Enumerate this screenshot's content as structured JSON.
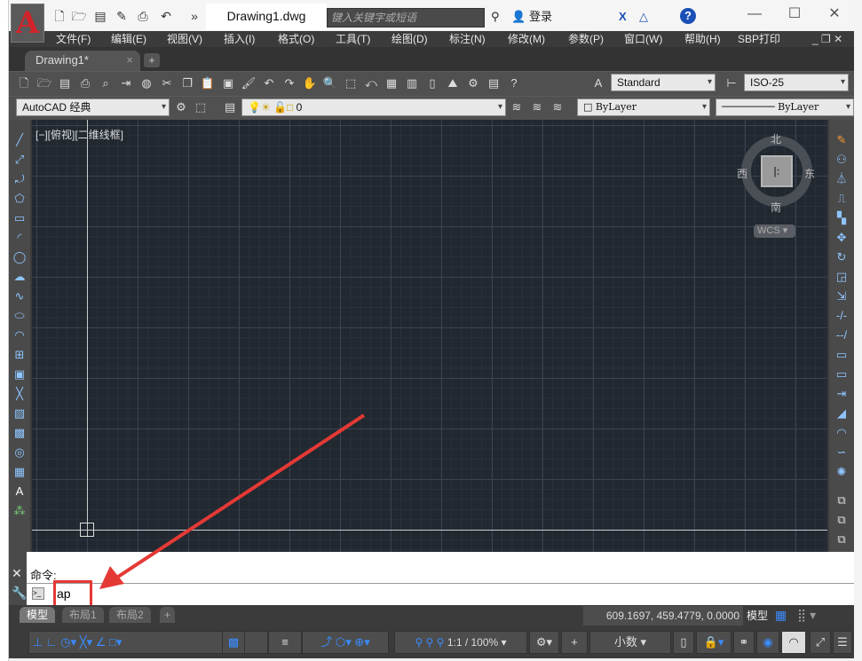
{
  "title": {
    "app_logo": "A",
    "document": "Drawing1.dwg",
    "search_placeholder": "键入关键字或短语",
    "signin": "登录",
    "window_controls": [
      "—",
      "☐",
      "✕"
    ]
  },
  "quick_access": [
    "new-icon",
    "open-icon",
    "save-icon",
    "saveas-icon",
    "plot-icon",
    "undo-icon",
    "more-icon"
  ],
  "menu": [
    "文件(F)",
    "编辑(E)",
    "视图(V)",
    "插入(I)",
    "格式(O)",
    "工具(T)",
    "绘图(D)",
    "标注(N)",
    "修改(M)",
    "参数(P)",
    "窗口(W)",
    "帮助(H)",
    "SBP打印"
  ],
  "tabs": {
    "active": "Drawing1*",
    "close": "×",
    "add": "+"
  },
  "toolbar": {
    "text_style": "Standard",
    "dim_style": "ISO-25",
    "workspace": "AutoCAD 经典",
    "layer": "0",
    "color": "ByLayer",
    "linetype": "ByLayer"
  },
  "viewport": {
    "label": "[−][俯视][二维线框]",
    "compass": {
      "north": "北",
      "south": "南",
      "east": "东",
      "west": "西"
    },
    "ucs": "WCS"
  },
  "command": {
    "history": "命令:",
    "input": "ap"
  },
  "layout_tabs": [
    "模型",
    "布局1",
    "布局2"
  ],
  "status": {
    "coords": "609.1697, 459.4779, 0.0000",
    "space": "模型",
    "scale": "1:1 / 100%",
    "units": "小数"
  },
  "colors": {
    "accent": "#d2232a",
    "canvas": "#212830",
    "highlight": "#e53935"
  }
}
